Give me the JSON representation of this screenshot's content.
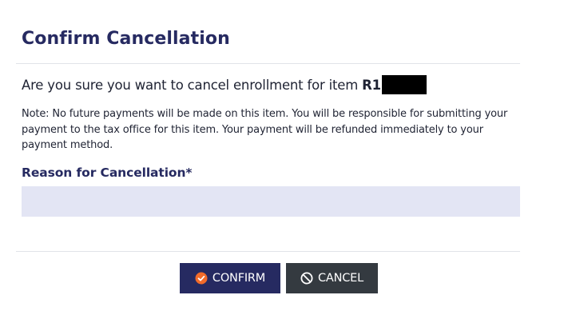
{
  "dialog": {
    "title": "Confirm Cancellation",
    "question_prefix": "Are you sure you want to cancel enrollment for item",
    "item_id_visible": "R1",
    "note": "Note: No future payments will be made on this item. You will be responsible for submitting your payment to the tax office for this item. Your payment will be refunded immediately to your payment method.",
    "reason_label": "Reason for Cancellation*",
    "reason_value": ""
  },
  "buttons": {
    "confirm_label": "CONFIRM",
    "cancel_label": "CANCEL"
  },
  "icons": {
    "confirm": "check-circle-icon",
    "cancel": "ban-icon"
  },
  "colors": {
    "title": "#262a61",
    "confirm_bg": "#262a61",
    "cancel_bg": "#343a40",
    "confirm_icon": "#f26b2a",
    "input_bg": "#e3e5f4"
  }
}
